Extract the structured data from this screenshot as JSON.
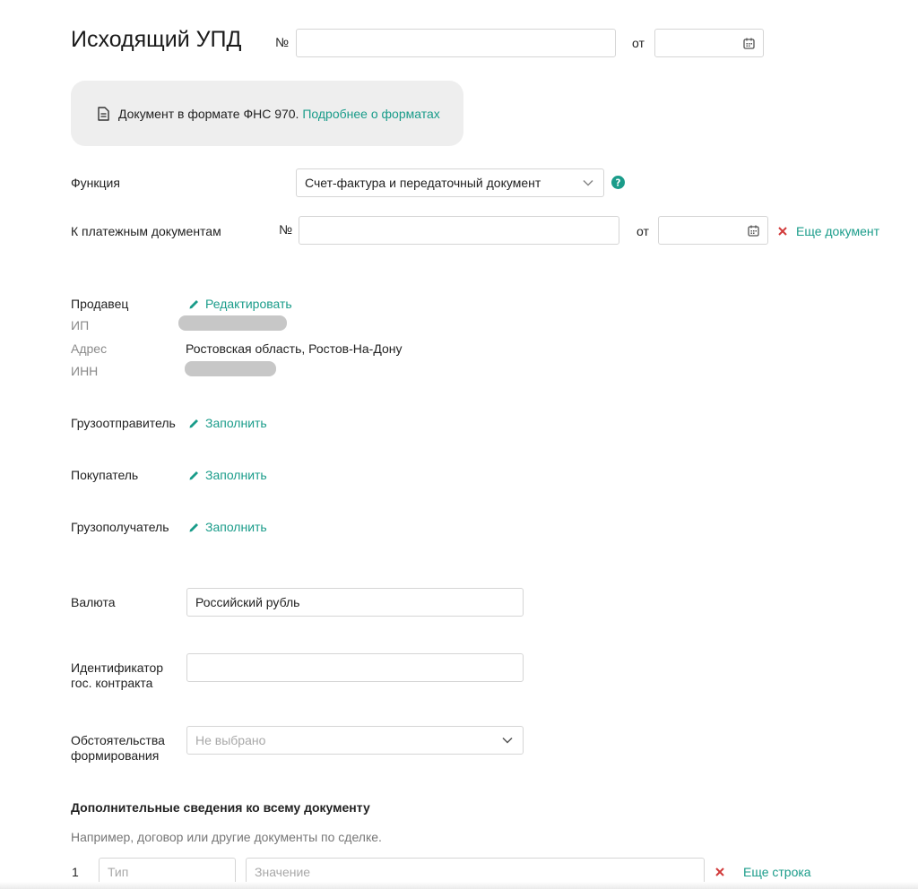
{
  "header": {
    "title": "Исходящий УПД",
    "number_label": "№",
    "number_value": "",
    "date_label": "от",
    "date_value": ""
  },
  "notice": {
    "text": "Документ в формате ФНС 970.",
    "link": "Подробнее о форматах"
  },
  "function_field": {
    "label": "Функция",
    "value": "Счет-фактура и передаточный документ"
  },
  "payment_docs": {
    "label": "К платежным документам",
    "number_label": "№",
    "number_value": "",
    "date_label": "от",
    "date_value": "",
    "add_link": "Еще документ"
  },
  "seller": {
    "label": "Продавец",
    "edit_link": "Редактировать",
    "type_label": "ИП",
    "address_label": "Адрес",
    "address_value": "Ростовская область, Ростов-На-Дону",
    "inn_label": "ИНН"
  },
  "shipper": {
    "label": "Грузоотправитель",
    "fill_link": "Заполнить"
  },
  "buyer": {
    "label": "Покупатель",
    "fill_link": "Заполнить"
  },
  "consignee": {
    "label": "Грузополучатель",
    "fill_link": "Заполнить"
  },
  "currency": {
    "label": "Валюта",
    "value": "Российский рубль"
  },
  "contract_id": {
    "label_line1": "Идентификатор",
    "label_line2": "гос. контракта",
    "value": ""
  },
  "circumstances": {
    "label_line1": "Обстоятельства",
    "label_line2": "формирования",
    "placeholder": "Не выбрано"
  },
  "additional": {
    "title": "Дополнительные сведения ко всему документу",
    "hint": "Например, договор или другие документы по сделке.",
    "rows": [
      {
        "index": "1",
        "type_placeholder": "Тип",
        "value_placeholder": "Значение"
      }
    ],
    "add_link": "Еще строка"
  },
  "colors": {
    "accent": "#1a9c8a",
    "danger": "#d23b3b",
    "redacted": "#c7c7c7",
    "notice_bg": "#eeeeee"
  }
}
